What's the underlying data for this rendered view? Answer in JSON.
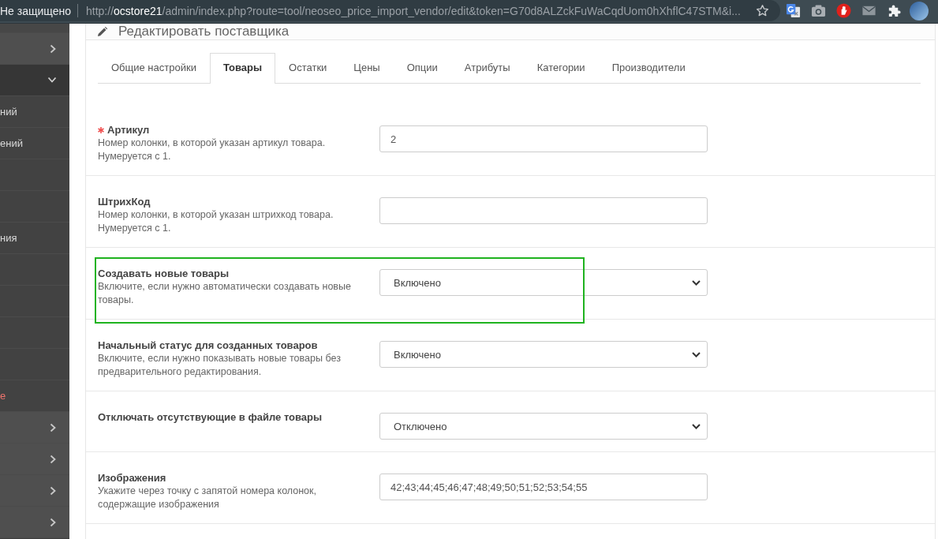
{
  "browser": {
    "security_label": "Не защищено",
    "url_scheme": "http://",
    "url_host": "ocstore21",
    "url_rest": "/admin/index.php?route=tool/neoseo_price_import_vendor/edit&token=G70d8ALZckFuWaCqdUom0hXhflC47STM&i..."
  },
  "sidebar": {
    "items": [
      {
        "kind": "plain"
      },
      {
        "kind": "header",
        "expanded": false
      },
      {
        "kind": "header",
        "expanded": true
      },
      {
        "kind": "link",
        "label": "ний",
        "selected": false
      },
      {
        "kind": "link",
        "label": "ений",
        "selected": false
      },
      {
        "kind": "link"
      },
      {
        "kind": "link"
      },
      {
        "kind": "link",
        "label": "ния",
        "selected": false
      },
      {
        "kind": "link"
      },
      {
        "kind": "link"
      },
      {
        "kind": "link"
      },
      {
        "kind": "link"
      },
      {
        "kind": "link",
        "label": "е",
        "selected": true
      },
      {
        "kind": "header",
        "expanded": false
      },
      {
        "kind": "header",
        "expanded": false
      },
      {
        "kind": "header",
        "expanded": false
      },
      {
        "kind": "header",
        "expanded": false
      }
    ]
  },
  "panel": {
    "title": "Редактировать поставщика",
    "tabs": [
      {
        "label": "Общие настройки",
        "selected": false
      },
      {
        "label": "Товары",
        "selected": true
      },
      {
        "label": "Остатки",
        "selected": false
      },
      {
        "label": "Цены",
        "selected": false
      },
      {
        "label": "Опции",
        "selected": false
      },
      {
        "label": "Атрибуты",
        "selected": false
      },
      {
        "label": "Категории",
        "selected": false
      },
      {
        "label": "Производители",
        "selected": false
      }
    ],
    "rows": [
      {
        "kind": "text",
        "label": "Артикул",
        "required": true,
        "help": "Номер колонки, в которой указан артикул товара. Нумеруется с 1.",
        "value": "2",
        "highlighted": false
      },
      {
        "kind": "text",
        "label": "ШтрихКод",
        "required": false,
        "help": "Номер колонки, в которой указан штрихкод товара. Нумеруется с 1.",
        "highlighted": false
      },
      {
        "kind": "select",
        "label": "Создавать новые товары",
        "required": false,
        "help": "Включите, если нужно автоматически создавать новые товары.",
        "value": "Включено",
        "highlighted": true
      },
      {
        "kind": "select",
        "label": "Начальный статус для созданных товаров",
        "required": false,
        "help": "Включите, если нужно показывать новые товары без предварительного редактирования.",
        "value": "Включено",
        "highlighted": false
      },
      {
        "kind": "select",
        "label": "Отключать отсутствующие в файле товары",
        "required": false,
        "value": "Отключено",
        "highlighted": false
      },
      {
        "kind": "text",
        "label": "Изображения",
        "required": false,
        "help": "Укажите через точку с запятой номера колонок, содержащие изображения",
        "value": "42;43;44;45;46;47;48;49;50;51;52;53;54;55",
        "highlighted": false
      }
    ]
  }
}
